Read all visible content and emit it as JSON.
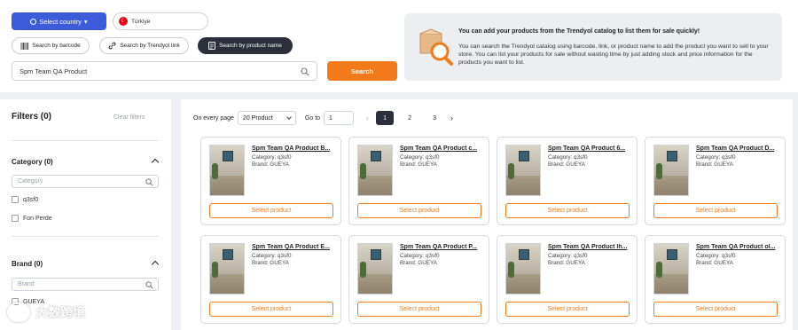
{
  "top": {
    "select_country_label": "Select country",
    "country_label": "Türkiye",
    "search_tabs": [
      {
        "label": "Search by barcode"
      },
      {
        "label": "Search by Trendyol link"
      },
      {
        "label": "Search by product name"
      }
    ],
    "search_value": "Spm Team QA Product",
    "search_button": "Search",
    "info_title": "You can add your products from the Trendyol catalog to list them for sale quickly!",
    "info_text": "You can search the Trendyol catalog using barcode, link, or product name to add the product you want to sell to your store. You can list your products for sale without wasting time by just adding stock and price information for the products you want to list."
  },
  "filters": {
    "title": "Filters (0)",
    "clear": "Clear filters",
    "category": {
      "title": "Category (0)",
      "placeholder": "Category",
      "options": [
        "q3sf0",
        "Fon Perde"
      ]
    },
    "brand": {
      "title": "Brand (0)",
      "placeholder": "Brand",
      "options": [
        "GUEYA"
      ]
    }
  },
  "pager": {
    "per_page_label": "On every page",
    "per_page_value": "20 Product",
    "goto_label": "Go to",
    "goto_value": "1",
    "prev": "‹",
    "pages": [
      "1",
      "2",
      "3"
    ],
    "current_page": "1",
    "next": "›"
  },
  "products": [
    {
      "title": "Spm Team QA Product B...",
      "category": "Category: q3sf0",
      "brand": "Brand: GUEYA",
      "button": "Select product"
    },
    {
      "title": "Spm Team QA Product c...",
      "category": "Category: q3sf0",
      "brand": "Brand: GUEYA",
      "button": "Select product"
    },
    {
      "title": "Spm Team QA Product 6...",
      "category": "Category: q3sf0",
      "brand": "Brand: GUEYA",
      "button": "Select product"
    },
    {
      "title": "Spm Team QA Product D...",
      "category": "Category: q3sf0",
      "brand": "Brand: GUEYA",
      "button": "Select product"
    },
    {
      "title": "Spm Team QA Product E...",
      "category": "Category: q3sf0",
      "brand": "Brand: GUEYA",
      "button": "Select product"
    },
    {
      "title": "Spm Team QA Product P...",
      "category": "Category: q3sf0",
      "brand": "Brand: GUEYA",
      "button": "Select product"
    },
    {
      "title": "Spm Team QA Product lh...",
      "category": "Category: q3sf0",
      "brand": "Brand: GUEYA",
      "button": "Select product"
    },
    {
      "title": "Spm Team QA Product ol...",
      "category": "Category: q3sf0",
      "brand": "Brand: GUEYA",
      "button": "Select product"
    }
  ],
  "watermark": "大数跨境",
  "colors": {
    "accent": "#f27a1a",
    "primary": "#3b5bdb",
    "dark": "#2b2f3b"
  }
}
